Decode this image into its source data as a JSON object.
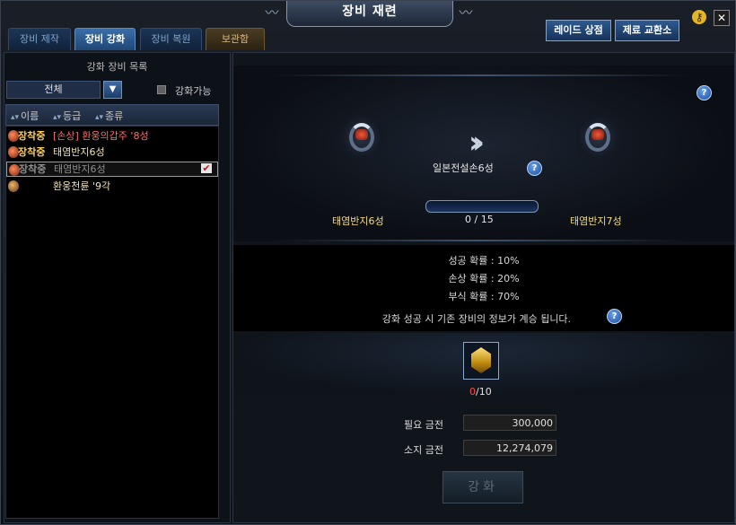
{
  "title": "장비 재련",
  "tabs": [
    {
      "label": "장비 제작"
    },
    {
      "label": "장비 강화"
    },
    {
      "label": "장비 복원"
    },
    {
      "label": "보관함"
    }
  ],
  "top_buttons": {
    "raid_shop": "레이드 상점",
    "material_exchange": "제료 교환소"
  },
  "left": {
    "title": "강화 장비 목록",
    "filter_value": "전체",
    "checkbox_label": "강화가능",
    "columns": [
      "이름",
      "등급",
      "종류"
    ],
    "items": [
      {
        "tag": "장착중",
        "name": "[손상] 환웅의갑주 '8성",
        "color": "#ff6b6b"
      },
      {
        "tag": "장착중",
        "name": "태염반지6성",
        "color": "#f0e2b6"
      },
      {
        "tag": "장착중",
        "name": "태염반지6성",
        "color": "#8f8f8f"
      },
      {
        "tag": "",
        "name": "환웅천륜 '9각",
        "color": "#f0e2b6"
      }
    ]
  },
  "enhance": {
    "source_name": "태염반지6성",
    "target_name": "태염반지7성",
    "stone_label": "일본전설손6성",
    "progress_text": "0 / 15",
    "success_rate": "성공  확률 : 10%",
    "damage_rate": "손상  확률 : 20%",
    "corrode_rate": "부식  확률 : 70%",
    "note": "강화  성공  시  기존  장비의  정보가  계승  됩니다.",
    "material_have": "0",
    "material_need": "/10",
    "required_label": "필요  금전",
    "required_value": "300,000",
    "owned_label": "소지  금전",
    "owned_value": "12,274,079",
    "button": "강화"
  }
}
